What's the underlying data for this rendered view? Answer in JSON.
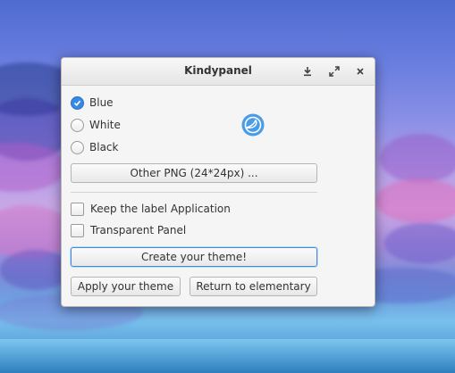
{
  "window": {
    "title": "Kindypanel",
    "controls": {
      "download_icon": "download-icon",
      "maximize_icon": "maximize-icon",
      "close_icon": "close-icon"
    }
  },
  "color_options": [
    {
      "label": "Blue",
      "checked": true
    },
    {
      "label": "White",
      "checked": false
    },
    {
      "label": "Black",
      "checked": false
    }
  ],
  "other_png_button": "Other PNG (24*24px) ...",
  "checkboxes": [
    {
      "label": "Keep the label Application",
      "checked": false
    },
    {
      "label": "Transparent Panel",
      "checked": false
    }
  ],
  "create_theme_button": "Create your theme!",
  "apply_theme_button": "Apply your theme",
  "return_button": "Return to elementary",
  "colors": {
    "accent": "#3689e6",
    "logo": "#4a9be8"
  }
}
